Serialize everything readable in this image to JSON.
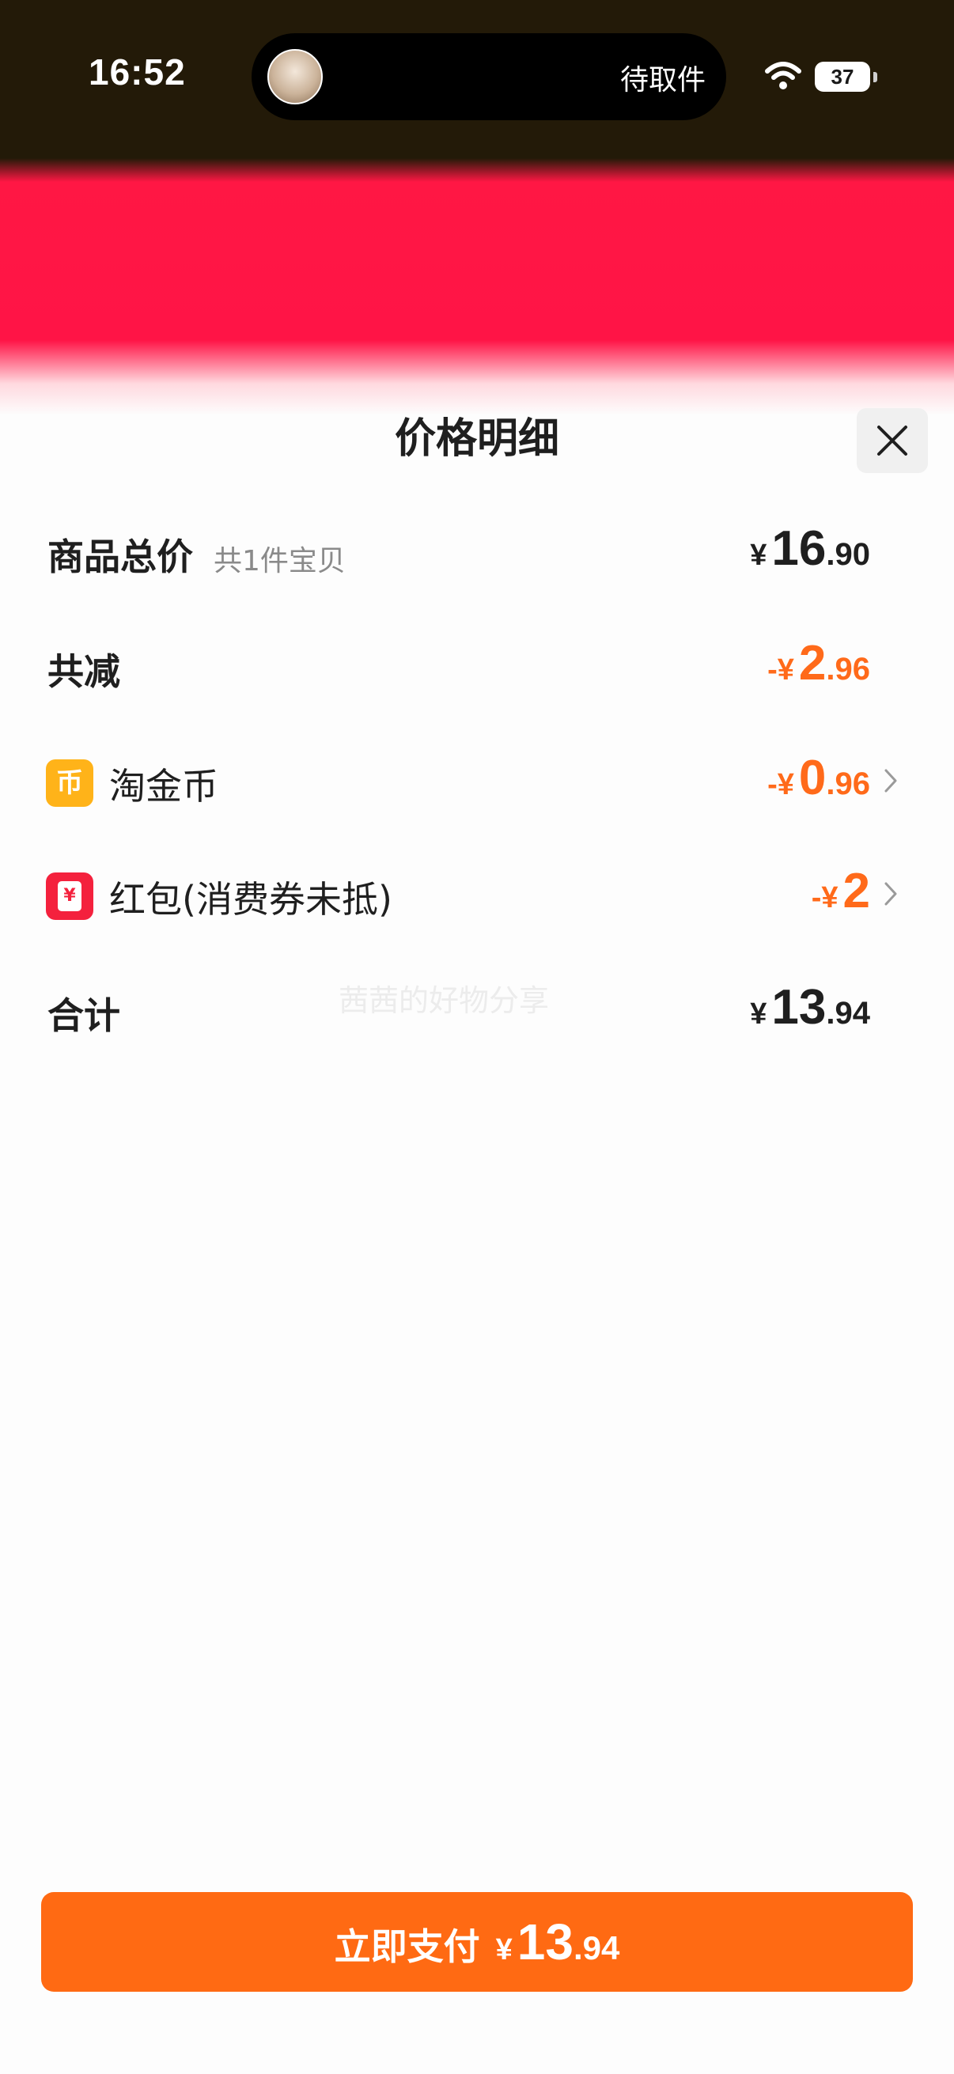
{
  "status_bar": {
    "time": "16:52",
    "island_text": "待取件",
    "battery": "37"
  },
  "sheet": {
    "title": "价格明细"
  },
  "rows": {
    "total_goods": {
      "label": "商品总价",
      "sub": "共1件宝贝",
      "symbol": "¥",
      "int": "16",
      "dec": ".90"
    },
    "total_discount": {
      "label": "共减",
      "symbol": "-¥",
      "int": "2",
      "dec": ".96"
    },
    "taojin_coin": {
      "icon_text": "币",
      "label": "淘金币",
      "symbol": "-¥",
      "int": "0",
      "dec": ".96"
    },
    "red_packet": {
      "icon_text": "¥",
      "label": "红包(消费券未抵)",
      "symbol": "-¥",
      "int": "2",
      "dec": ""
    },
    "sum": {
      "label": "合计",
      "symbol": "¥",
      "int": "13",
      "dec": ".94"
    }
  },
  "watermark": "茜茜的好物分享",
  "pay_button": {
    "label": "立即支付",
    "symbol": "¥",
    "int": "13",
    "dec": ".94"
  },
  "colors": {
    "accent_orange": "#ff6a13",
    "discount_orange": "#ff6a1a",
    "banner_red": "#ff1744"
  }
}
